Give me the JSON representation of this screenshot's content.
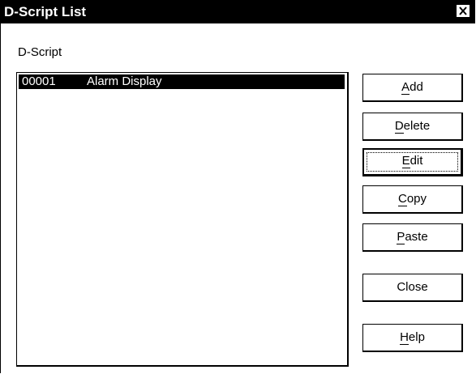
{
  "window": {
    "title": "D-Script List"
  },
  "group": {
    "label": "D-Script"
  },
  "list": {
    "items": [
      {
        "number": "00001",
        "name": "Alarm Display",
        "selected": true
      }
    ]
  },
  "buttons": {
    "add": {
      "mnemonic": "A",
      "rest": "dd"
    },
    "delete": {
      "mnemonic": "D",
      "rest": "elete"
    },
    "edit": {
      "mnemonic": "E",
      "rest": "dit"
    },
    "copy": {
      "mnemonic": "C",
      "rest": "opy"
    },
    "paste": {
      "mnemonic": "P",
      "rest": "aste"
    },
    "close": {
      "label": "Close"
    },
    "help": {
      "mnemonic": "H",
      "rest": "elp"
    }
  },
  "colors": {
    "title_bar": "#000000",
    "selection": "#000000",
    "background": "#ffffff"
  },
  "icons": {
    "close": "close-icon"
  }
}
